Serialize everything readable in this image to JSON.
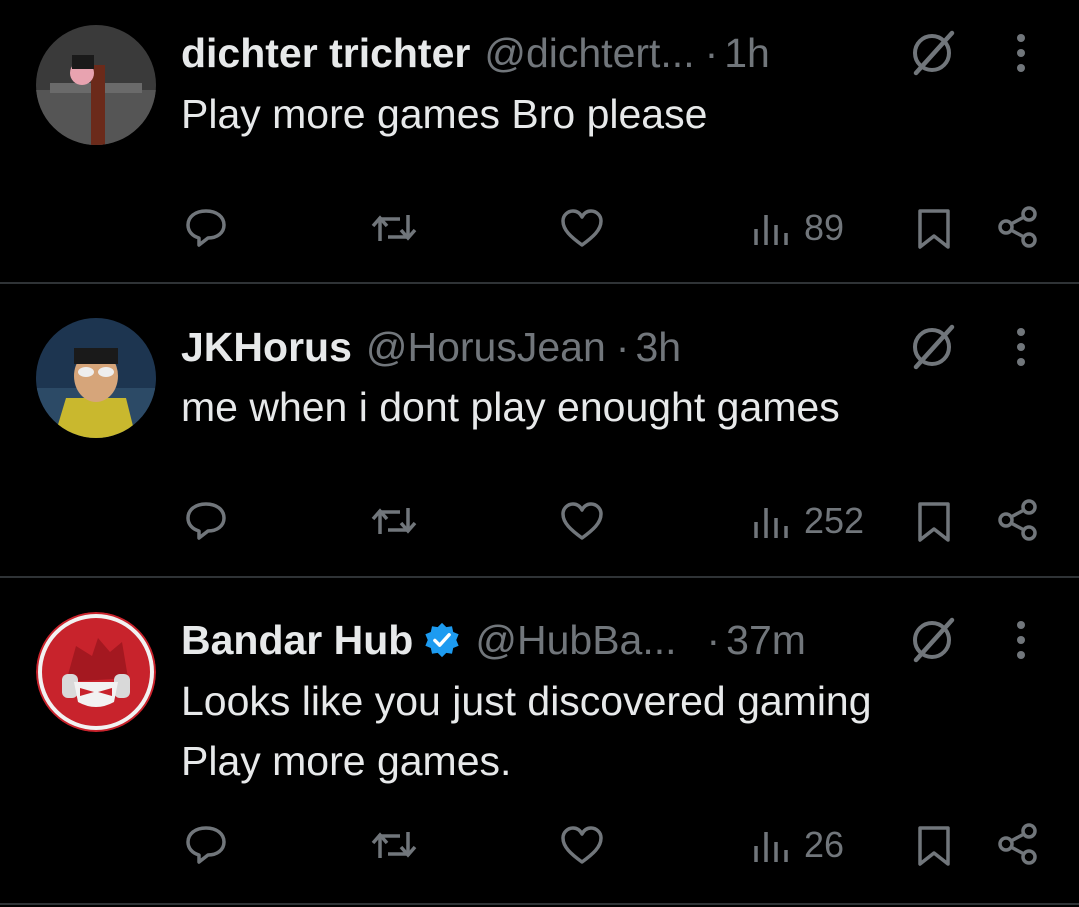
{
  "tweets": [
    {
      "name": "dichter trichter",
      "handle": "@dichtert...",
      "dot": "·",
      "time": "1h",
      "verified": false,
      "text_lines": [
        "Play more games Bro please"
      ],
      "views": "89"
    },
    {
      "name": "JKHorus",
      "handle": "@HorusJean",
      "dot": "·",
      "time": "3h",
      "verified": false,
      "text_lines": [
        "me when i dont play enought games"
      ],
      "views": "252"
    },
    {
      "name": "Bandar Hub",
      "handle": "@HubBa...",
      "dot": "·",
      "time": "37m",
      "verified": true,
      "text_lines": [
        "Looks like you just discovered gaming",
        "Play more games."
      ],
      "views": "26"
    }
  ],
  "icons": {
    "reply": "reply-icon",
    "repost": "repost-icon",
    "like": "heart-icon",
    "views": "views-icon",
    "bookmark": "bookmark-icon",
    "share": "share-icon",
    "grok": "grok-icon",
    "more": "more-icon",
    "verified": "verified-badge-icon"
  },
  "colors": {
    "background": "#000000",
    "text": "#e7e9ea",
    "muted": "#71767b",
    "divider": "#2f3336",
    "verified": "#1d9bf0"
  }
}
